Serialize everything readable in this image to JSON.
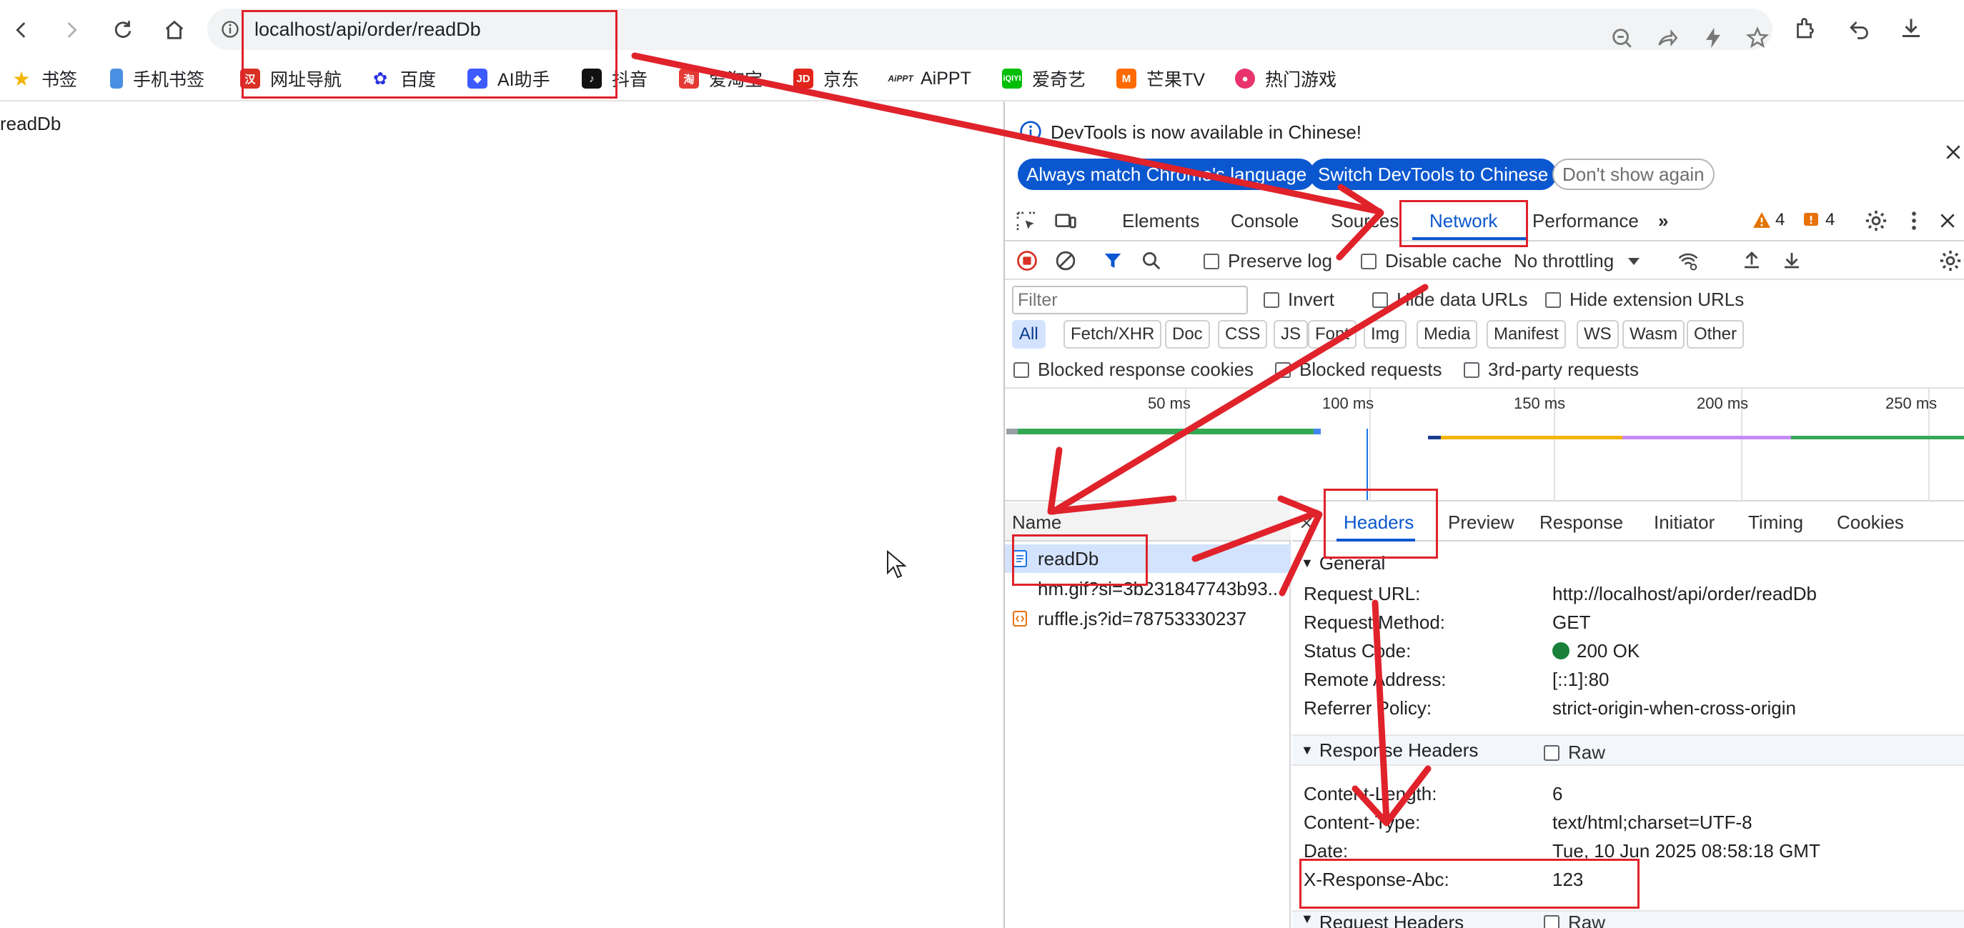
{
  "browser": {
    "url": "localhost/api/order/readDb",
    "bookmarks": [
      {
        "label": "书签",
        "icon": "star-icon",
        "color": "#f4b400"
      },
      {
        "label": "手机书签",
        "icon": "phone-icon",
        "color": "#4a90e2"
      },
      {
        "label": "网址导航",
        "icon": "nav-site-icon",
        "color": "#d93025"
      },
      {
        "label": "百度",
        "icon": "baidu-icon",
        "color": "#2932e1"
      },
      {
        "label": "AI助手",
        "icon": "ai-assistant-icon",
        "color": "#3d5afe"
      },
      {
        "label": "抖音",
        "icon": "douyin-icon",
        "color": "#111111"
      },
      {
        "label": "爱淘宝",
        "icon": "taobao-icon",
        "color": "#e53935"
      },
      {
        "label": "京东",
        "icon": "jd-icon",
        "color": "#e1251b"
      },
      {
        "label": "AiPPT",
        "icon": "aippt-icon",
        "color": "#222222"
      },
      {
        "label": "爱奇艺",
        "icon": "iqiyi-icon",
        "color": "#00be06"
      },
      {
        "label": "芒果TV",
        "icon": "mango-icon",
        "color": "#ff6a00"
      },
      {
        "label": "热门游戏",
        "icon": "game-icon",
        "color": "#e8336d"
      }
    ]
  },
  "page": {
    "body_text": "readDb"
  },
  "devtools": {
    "notice": {
      "text": "DevTools is now available in Chinese!",
      "btn_match": "Always match Chrome's language",
      "btn_switch": "Switch DevTools to Chinese",
      "btn_dismiss": "Don't show again"
    },
    "tabs": [
      "Elements",
      "Console",
      "Sources",
      "Network",
      "Performance"
    ],
    "active_tab": "Network",
    "warnings": "4",
    "errors": "4",
    "toolbar": {
      "preserve_log": "Preserve log",
      "disable_cache": "Disable cache",
      "throttling": "No throttling"
    },
    "filter": {
      "placeholder": "Filter",
      "invert": "Invert",
      "hide_data_urls": "Hide data URLs",
      "hide_extension_urls": "Hide extension URLs",
      "types": [
        "All",
        "Fetch/XHR",
        "Doc",
        "CSS",
        "JS",
        "Font",
        "Img",
        "Media",
        "Manifest",
        "WS",
        "Wasm",
        "Other"
      ],
      "blocked_cookies": "Blocked response cookies",
      "blocked_requests": "Blocked requests",
      "third_party": "3rd-party requests"
    },
    "timeline_ticks": [
      "50 ms",
      "100 ms",
      "150 ms",
      "200 ms",
      "250 ms"
    ],
    "requests_header": "Name",
    "requests": [
      {
        "name": "readDb",
        "icon": "document-icon"
      },
      {
        "name": "hm.gif?si=3b231847743b93...",
        "icon": ""
      },
      {
        "name": "ruffle.js?id=78753330237",
        "icon": "script-icon"
      }
    ],
    "detail_tabs": [
      "Headers",
      "Preview",
      "Response",
      "Initiator",
      "Timing",
      "Cookies"
    ],
    "general": {
      "title": "General",
      "rows": [
        {
          "key": "Request URL:",
          "value": "http://localhost/api/order/readDb"
        },
        {
          "key": "Request Method:",
          "value": "GET"
        },
        {
          "key": "Status Code:",
          "value": "200 OK"
        },
        {
          "key": "Remote Address:",
          "value": "[::1]:80"
        },
        {
          "key": "Referrer Policy:",
          "value": "strict-origin-when-cross-origin"
        }
      ]
    },
    "response_headers": {
      "title": "Response Headers",
      "raw": "Raw",
      "rows": [
        {
          "key": "Content-Length:",
          "value": "6"
        },
        {
          "key": "Content-Type:",
          "value": "text/html;charset=UTF-8"
        },
        {
          "key": "Date:",
          "value": "Tue, 10 Jun 2025 08:58:18 GMT"
        },
        {
          "key": "X-Response-Abc:",
          "value": "123"
        }
      ]
    },
    "request_headers": {
      "title": "Request Headers",
      "raw": "Raw"
    }
  },
  "annotation_color": "#e0222b"
}
